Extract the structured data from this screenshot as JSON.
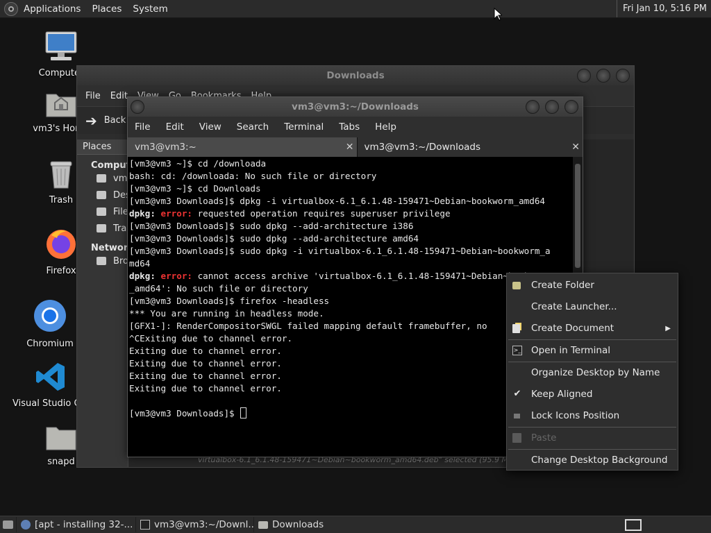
{
  "top_panel": {
    "menus": [
      "Applications",
      "Places",
      "System"
    ],
    "clock": "Fri Jan 10,  5:16 PM"
  },
  "desktop_icons": [
    {
      "label": "Computer",
      "icon": "computer-icon"
    },
    {
      "label": "vm3's Home",
      "icon": "home-folder-icon"
    },
    {
      "label": "Trash",
      "icon": "trash-icon"
    },
    {
      "label": "Firefox",
      "icon": "firefox-icon"
    },
    {
      "label": "Chromium",
      "icon": "chromium-icon"
    },
    {
      "label": "Visual Studio Code",
      "icon": "vscode-icon"
    },
    {
      "label": "snapd",
      "icon": "folder-icon"
    }
  ],
  "file_manager": {
    "title": "Downloads",
    "menus": [
      "File",
      "Edit",
      "View",
      "Go",
      "Bookmarks",
      "Help"
    ],
    "toolbar_back": "Back",
    "sidebar_header": "Places",
    "sidebar_sections": {
      "computer": "Computer",
      "network": "Network"
    },
    "sidebar_items": [
      "vm3",
      "Desktop",
      "File System",
      "Trash"
    ],
    "network_items": [
      "Browse Network"
    ],
    "status": "virtualbox-6.1_6.1.48-159471~Debian~bookworm_amd64.deb\" selected (95.9 MB), Free space"
  },
  "terminal": {
    "title": "vm3@vm3:~/Downloads",
    "menus": [
      "File",
      "Edit",
      "View",
      "Search",
      "Terminal",
      "Tabs",
      "Help"
    ],
    "tabs": [
      {
        "label": "vm3@vm3:~",
        "active": false
      },
      {
        "label": "vm3@vm3:~/Downloads",
        "active": true
      }
    ],
    "lines": [
      "[vm3@vm3 ~]$ cd /downloada",
      "bash: cd: /downloada: No such file or directory",
      "[vm3@vm3 ~]$ cd Downloads",
      "[vm3@vm3 Downloads]$ dpkg -i virtualbox-6.1_6.1.48-159471~Debian~bookworm_amd64",
      "dpkg: error: requested operation requires superuser privilege",
      "[vm3@vm3 Downloads]$ sudo dpkg --add-architecture i386",
      "[vm3@vm3 Downloads]$ sudo dpkg --add-architecture amd64",
      "[vm3@vm3 Downloads]$ sudo dpkg -i virtualbox-6.1_6.1.48-159471~Debian~bookworm_a",
      "md64",
      "dpkg: error: cannot access archive 'virtualbox-6.1_6.1.48-159471~Debian~bookworm",
      "_amd64': No such file or directory",
      "[vm3@vm3 Downloads]$ firefox -headless",
      "*** You are running in headless mode.",
      "[GFX1-]: RenderCompositorSWGL failed mapping default framebuffer, no",
      "^CExiting due to channel error.",
      "Exiting due to channel error.",
      "Exiting due to channel error.",
      "Exiting due to channel error.",
      "Exiting due to channel error.",
      "",
      "[vm3@vm3 Downloads]$ "
    ]
  },
  "context_menu": {
    "items": [
      {
        "label": "Create Folder",
        "icon": "new-folder-icon"
      },
      {
        "label": "Create Launcher...",
        "icon": ""
      },
      {
        "label": "Create Document",
        "icon": "new-document-icon",
        "submenu": true
      },
      {
        "label": "Open in Terminal",
        "icon": "terminal-icon"
      },
      {
        "label": "Organize Desktop by Name",
        "icon": ""
      },
      {
        "label": "Keep Aligned",
        "icon": "checkmark-icon",
        "checked": true
      },
      {
        "label": "Lock Icons Position",
        "icon": "lock-icon"
      },
      {
        "label": "Paste",
        "icon": "paste-icon",
        "disabled": true
      },
      {
        "label": "Change Desktop Background",
        "icon": ""
      }
    ]
  },
  "taskbar": {
    "tasks": [
      {
        "label": "[apt - installing 32-...",
        "icon": "browser-icon"
      },
      {
        "label": "vm3@vm3:~/Downl...",
        "icon": "terminal-icon"
      },
      {
        "label": "Downloads",
        "icon": "folder-icon"
      }
    ]
  },
  "colors": {
    "error": "#ee3333",
    "panel": "#2b2b2b",
    "desktop": "#141414"
  }
}
